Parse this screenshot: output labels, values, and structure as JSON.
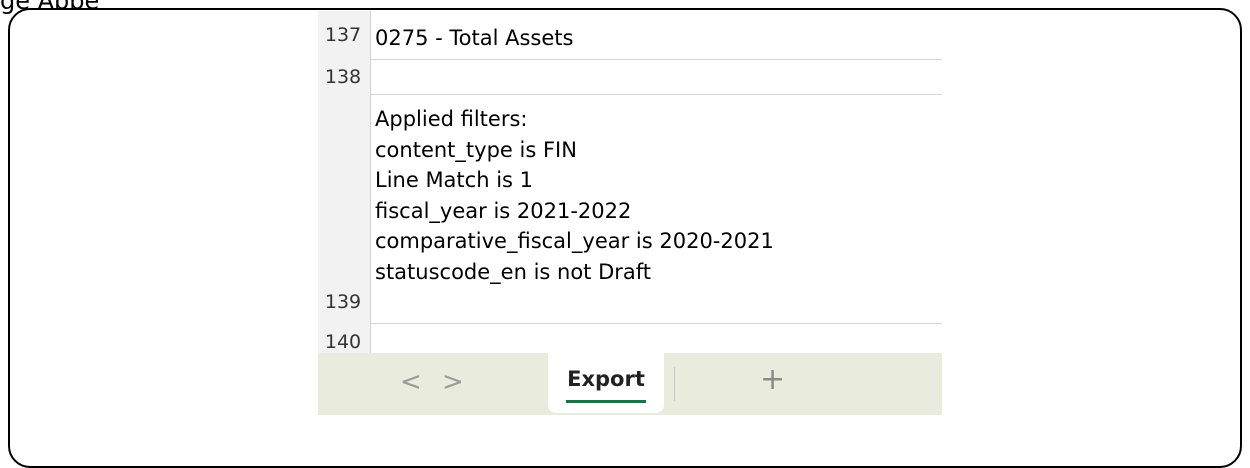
{
  "caption_fragment": "ge Appe",
  "grid": {
    "partial_row": {
      "number": "137",
      "value": "0275 - Total Assets"
    },
    "row_138": {
      "number": "138",
      "value": ""
    },
    "row_139": {
      "number": "139",
      "lines": [
        "Applied filters:",
        "content_type is FIN",
        "Line Match is 1",
        "fiscal_year is 2021-2022",
        "comparative_fiscal_year is 2020-2021",
        "statuscode_en is not Draft"
      ]
    },
    "row_140": {
      "number": "140",
      "value": ""
    }
  },
  "tabbar": {
    "prev_icon": "chevron-left-icon",
    "next_icon": "chevron-right-icon",
    "prev_glyph": "<",
    "next_glyph": ">",
    "active_tab": "Export",
    "add_glyph": "+",
    "colors": {
      "bar_background": "#e9ecdc",
      "active_underline": "#1e7145"
    }
  }
}
